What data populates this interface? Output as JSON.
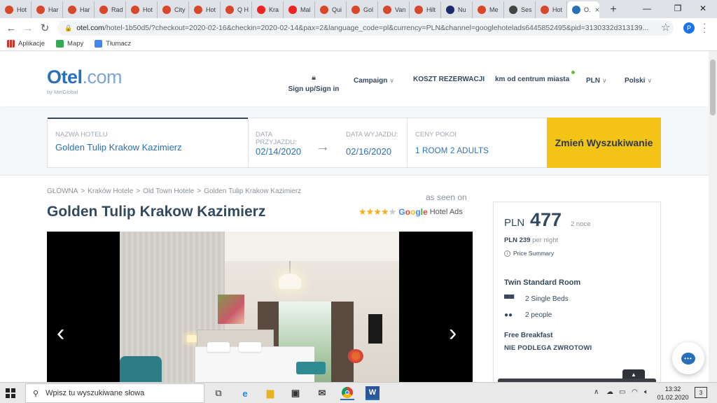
{
  "browser": {
    "tabs": [
      {
        "label": "Hot",
        "color": "#d9472b"
      },
      {
        "label": "Har",
        "color": "#d9472b"
      },
      {
        "label": "Har",
        "color": "#d9472b"
      },
      {
        "label": "Rad",
        "color": "#d9472b"
      },
      {
        "label": "Hot",
        "color": "#d9472b"
      },
      {
        "label": "City",
        "color": "#d9472b"
      },
      {
        "label": "Hot",
        "color": "#d9472b"
      },
      {
        "label": "Q H",
        "color": "#d9472b"
      },
      {
        "label": "Kra",
        "color": "#e22"
      },
      {
        "label": "Mal",
        "color": "#e22"
      },
      {
        "label": "Qui",
        "color": "#d9472b"
      },
      {
        "label": "Gol",
        "color": "#d9472b"
      },
      {
        "label": "Van",
        "color": "#d9472b"
      },
      {
        "label": "Hilt",
        "color": "#d9472b"
      },
      {
        "label": "Nu",
        "color": "#1b2b6b"
      },
      {
        "label": "Me",
        "color": "#d9472b"
      },
      {
        "label": "Ses",
        "color": "#444"
      },
      {
        "label": "Hot",
        "color": "#d9472b"
      }
    ],
    "active_tab": {
      "label": "O.",
      "close": "×"
    },
    "new_tab": "+",
    "window_controls": {
      "minimize": "—",
      "maximize": "❐",
      "close": "✕"
    },
    "url_host": "otel.com",
    "url_rest": "/hotel-1b50d5/?checkout=2020-02-16&checkin=2020-02-14&pax=2&language_code=pl&currency=PLN&channel=googlehotelads6445852495&pid=3130332d313139...",
    "profile_initial": "P",
    "bookmarks": [
      {
        "label": "Aplikacje",
        "color": "#d93025"
      },
      {
        "label": "Mapy",
        "color": "#34a853"
      },
      {
        "label": "Tłumacz",
        "color": "#4285f4"
      }
    ]
  },
  "site": {
    "logo_main": "Otel",
    "logo_dot": ".com",
    "logo_sub": "by MetGlobal",
    "signin": "Sign up/Sign in",
    "nav": {
      "campaign": "Campaign",
      "cost": "KOSZT REZERWACJI",
      "distance": "km od centrum miasta",
      "currency": "PLN",
      "language": "Polski"
    }
  },
  "search": {
    "hotel_label": "NAZWA HOTELU",
    "hotel_value": "Golden Tulip Krakow Kazimierz",
    "checkin_label": "DATA PRZYJAZDU:",
    "checkin_value": "02/14/2020",
    "checkout_label": "DATA WYJAZDU:",
    "checkout_value": "02/16/2020",
    "rooms_label": "CENY POKOI",
    "rooms_value": "1 ROOM 2 ADULTS",
    "change_button": "Zmień Wyszukiwanie"
  },
  "breadcrumb": {
    "home": "GŁÓWNA",
    "city": "Kraków Hotele",
    "district": "Old Town Hotele",
    "hotel": "Golden Tulip Krakow Kazimierz",
    "separator": ">"
  },
  "hotel": {
    "title": "Golden Tulip Krakow Kazimierz",
    "as_seen_on": "as seen on",
    "stars_full": "★★★★",
    "stars_empty": "★",
    "google_word": "Google",
    "google_suffix": "Hotel Ads",
    "gallery_prev": "‹",
    "gallery_next": "›"
  },
  "price": {
    "currency": "PLN",
    "amount": "477",
    "nights": "2 noce",
    "per_night_amount": "PLN 239",
    "per_night_text": "per night",
    "summary_link": "Price Summary",
    "room_name": "Twin Standard Room",
    "beds": "2 Single Beds",
    "people": "2 people",
    "breakfast": "Free Breakfast",
    "refund": "NIE PODLEGA ZWROTOWI"
  },
  "taskbar": {
    "search_placeholder": "Wpisz tu wyszukiwane słowa",
    "time": "13:32",
    "date": "01.02.2020",
    "notifications": "3"
  }
}
